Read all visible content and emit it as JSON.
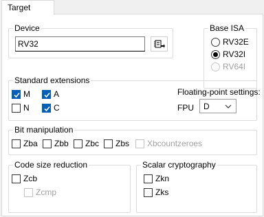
{
  "tabs": [
    {
      "label": "Target"
    }
  ],
  "device": {
    "legend": "Device",
    "value": "RV32",
    "browse_icon": "chip-browse-icon"
  },
  "base_isa": {
    "legend": "Base ISA",
    "options": [
      {
        "label": "RV32E",
        "selected": false,
        "enabled": true
      },
      {
        "label": "RV32I",
        "selected": true,
        "enabled": true
      },
      {
        "label": "RV64I",
        "selected": false,
        "enabled": false
      }
    ]
  },
  "standard_extensions": {
    "legend": "Standard extensions",
    "items": [
      {
        "label": "M",
        "checked": true
      },
      {
        "label": "A",
        "checked": true
      },
      {
        "label": "N",
        "checked": false
      },
      {
        "label": "C",
        "checked": true
      }
    ],
    "fp_settings_label": "Floating-point settings:",
    "fpu_label": "FPU",
    "fpu_value": "D"
  },
  "bit_manipulation": {
    "legend": "Bit manipulation",
    "items": [
      {
        "label": "Zba",
        "checked": false,
        "enabled": true
      },
      {
        "label": "Zbb",
        "checked": false,
        "enabled": true
      },
      {
        "label": "Zbc",
        "checked": false,
        "enabled": true
      },
      {
        "label": "Zbs",
        "checked": false,
        "enabled": true
      },
      {
        "label": "Xbcountzeroes",
        "checked": false,
        "enabled": false
      }
    ]
  },
  "code_size": {
    "legend": "Code size reduction",
    "items": [
      {
        "label": "Zcb",
        "checked": false,
        "enabled": true
      },
      {
        "label": "Zcmp",
        "checked": false,
        "enabled": false
      }
    ]
  },
  "scalar_crypto": {
    "legend": "Scalar cryptography",
    "items": [
      {
        "label": "Zkn",
        "checked": false,
        "enabled": true
      },
      {
        "label": "Zks",
        "checked": false,
        "enabled": true
      }
    ]
  },
  "colors": {
    "accent": "#005fb8",
    "disabled_text": "#a0a0a0"
  }
}
